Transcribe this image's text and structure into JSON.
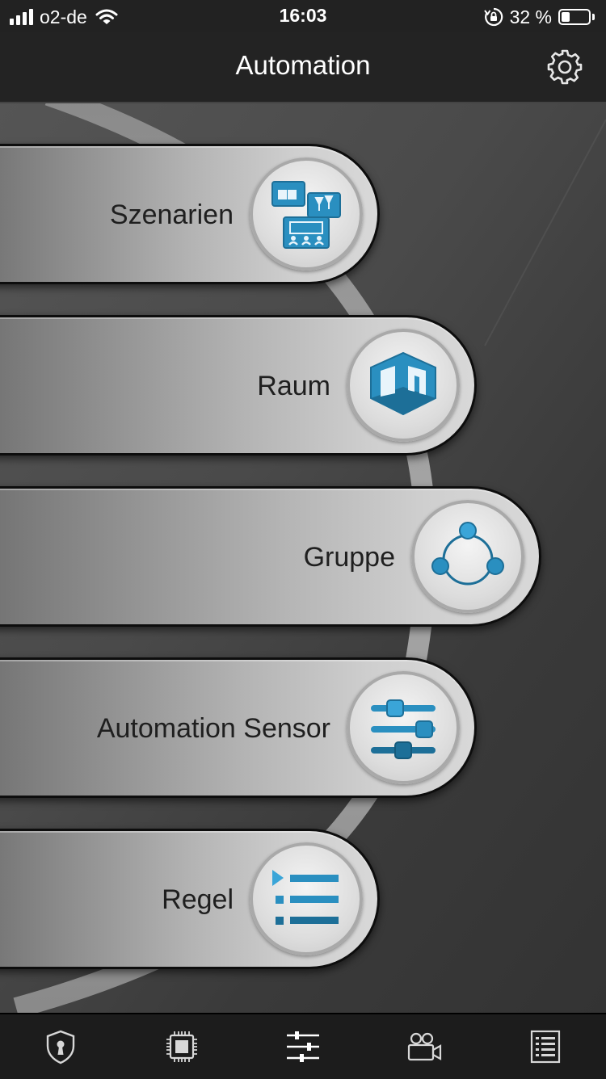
{
  "status_bar": {
    "carrier": "o2-de",
    "time": "16:03",
    "battery_percent": "32 %",
    "battery_level": 0.32
  },
  "nav": {
    "title": "Automation",
    "settings_icon": "gear-icon"
  },
  "menu": {
    "items": [
      {
        "label": "Szenarien",
        "icon": "scenes-icon"
      },
      {
        "label": "Raum",
        "icon": "room-icon"
      },
      {
        "label": "Gruppe",
        "icon": "group-icon"
      },
      {
        "label": "Automation Sensor",
        "icon": "sensor-sliders-icon"
      },
      {
        "label": "Regel",
        "icon": "rule-list-icon"
      }
    ]
  },
  "tab_bar": {
    "tabs": [
      {
        "icon": "shield-lock-icon"
      },
      {
        "icon": "chip-icon"
      },
      {
        "icon": "sliders-icon",
        "active": true
      },
      {
        "icon": "camera-icon"
      },
      {
        "icon": "list-icon"
      }
    ]
  },
  "colors": {
    "accent_blue": "#2a8fc0",
    "accent_blue_dark": "#1d6f98",
    "pill_text": "#1f1f1f"
  }
}
